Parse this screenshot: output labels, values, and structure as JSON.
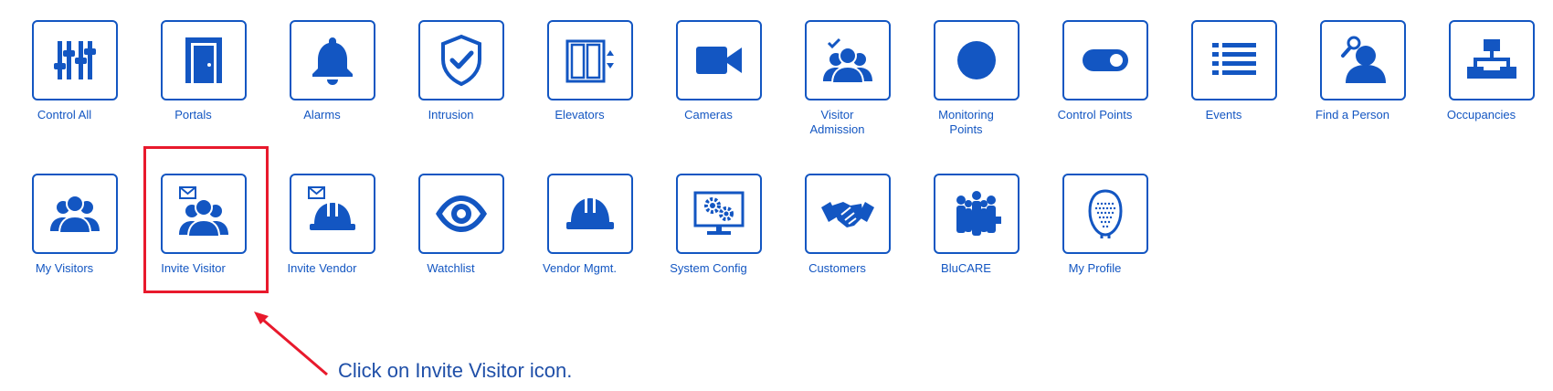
{
  "colors": {
    "icon": "#1356c2",
    "highlight": "#e8192c",
    "instruction": "#1f4fa8"
  },
  "row1": [
    {
      "label": "Control All",
      "icon": "sliders-icon"
    },
    {
      "label": "Portals",
      "icon": "door-icon"
    },
    {
      "label": "Alarms",
      "icon": "bell-icon"
    },
    {
      "label": "Intrusion",
      "icon": "shield-check-icon"
    },
    {
      "label": "Elevators",
      "icon": "elevator-icon"
    },
    {
      "label": "Cameras",
      "icon": "video-camera-icon"
    },
    {
      "label": "Visitor\nAdmission",
      "icon": "visitor-check-icon"
    },
    {
      "label": "Monitoring\nPoints",
      "icon": "circle-icon"
    },
    {
      "label": "Control Points",
      "icon": "toggle-icon"
    },
    {
      "label": "Events",
      "icon": "list-icon"
    },
    {
      "label": "Find a Person",
      "icon": "person-search-icon"
    },
    {
      "label": "Occupancies",
      "icon": "org-chart-icon"
    }
  ],
  "row2": [
    {
      "label": "My Visitors",
      "icon": "people-icon"
    },
    {
      "label": "Invite Visitor",
      "icon": "people-envelope-icon"
    },
    {
      "label": "Invite Vendor",
      "icon": "hardhat-envelope-icon"
    },
    {
      "label": "Watchlist",
      "icon": "eye-icon"
    },
    {
      "label": "Vendor Mgmt.",
      "icon": "hardhat-icon"
    },
    {
      "label": "System Config",
      "icon": "monitor-gears-icon"
    },
    {
      "label": "Customers",
      "icon": "handshake-icon"
    },
    {
      "label": "BluCARE",
      "icon": "team-icon"
    },
    {
      "label": "My Profile",
      "icon": "face-scan-icon"
    }
  ],
  "instruction": "Click on Invite Visitor icon."
}
